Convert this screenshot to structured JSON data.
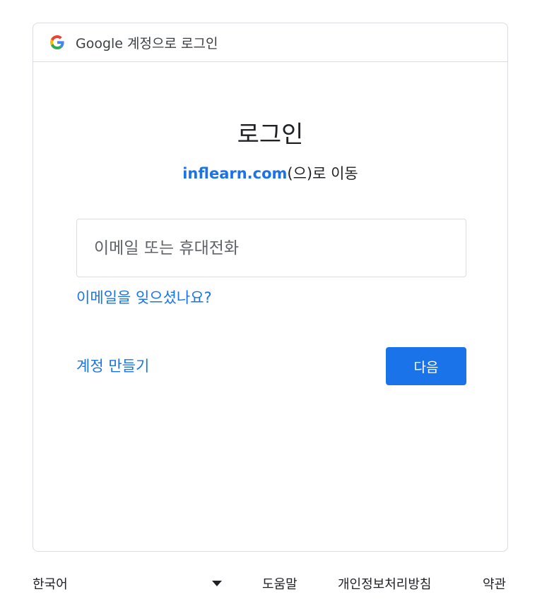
{
  "header": {
    "title": "Google 계정으로 로그인",
    "logo_icon": "google-g-icon"
  },
  "main": {
    "title": "로그인",
    "subtitle_domain": "inflearn.com",
    "subtitle_suffix": "(으)로 이동",
    "email_input": {
      "placeholder": "이메일 또는 휴대전화",
      "value": ""
    },
    "forgot_email_label": "이메일을 잊으셨나요?",
    "create_account_label": "계정 만들기",
    "next_label": "다음"
  },
  "footer": {
    "language": "한국어",
    "help": "도움말",
    "privacy": "개인정보처리방침",
    "terms": "약관"
  },
  "colors": {
    "accent": "#1a73e8",
    "border": "#dadce0",
    "text": "#202124"
  }
}
